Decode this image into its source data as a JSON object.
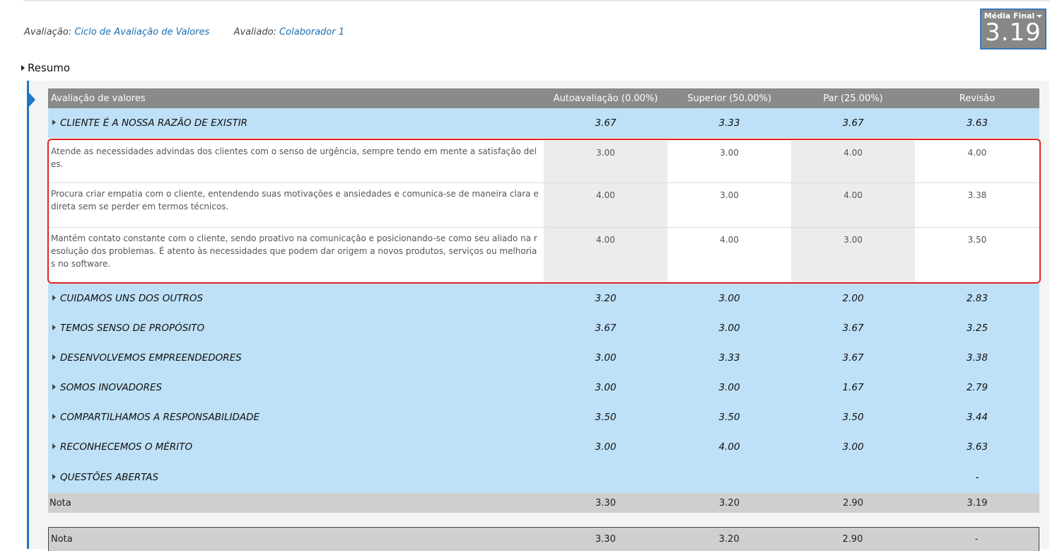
{
  "meta": {
    "evaluation_label": "Avaliação:",
    "evaluation_value": "Ciclo de Avaliação de Valores",
    "evaluated_label": "Avaliado:",
    "evaluated_value": "Colaborador 1"
  },
  "score": {
    "label": "Média Final",
    "value": "3.19"
  },
  "summary": {
    "label": "Resumo"
  },
  "table": {
    "headers": [
      "Avaliação de valores",
      "Autoavaliação (0.00%)",
      "Superior (50.00%)",
      "Par (25.00%)",
      "Revisão"
    ],
    "groups": [
      {
        "name": "CLIENTE É A NOSSA RAZÃO DE EXISTIR",
        "values": [
          "3.67",
          "3.33",
          "3.67",
          "3.63"
        ]
      },
      {
        "name": "CUIDAMOS UNS DOS OUTROS",
        "values": [
          "3.20",
          "3.00",
          "2.00",
          "2.83"
        ]
      },
      {
        "name": "TEMOS SENSO DE PROPÓSITO",
        "values": [
          "3.67",
          "3.00",
          "3.67",
          "3.25"
        ]
      },
      {
        "name": "DESENVOLVEMOS EMPREENDEDORES",
        "values": [
          "3.00",
          "3.33",
          "3.67",
          "3.38"
        ]
      },
      {
        "name": "SOMOS INOVADORES",
        "values": [
          "3.00",
          "3.00",
          "1.67",
          "2.79"
        ]
      },
      {
        "name": "COMPARTILHAMOS A RESPONSABILIDADE",
        "values": [
          "3.50",
          "3.50",
          "3.50",
          "3.44"
        ]
      },
      {
        "name": "RECONHECEMOS O MÉRITO",
        "values": [
          "3.00",
          "4.00",
          "3.00",
          "3.63"
        ]
      },
      {
        "name": "QUESTÕES ABERTAS",
        "values": [
          "",
          "",
          "",
          "-"
        ]
      }
    ],
    "details": [
      {
        "text": "Atende as necessidades advindas dos clientes com o senso de urgência, sempre tendo em mente a satisfação deles.",
        "values": [
          "3.00",
          "3.00",
          "4.00",
          "4.00"
        ]
      },
      {
        "text": "Procura criar empatia com o cliente, entendendo suas motivações e ansiedades e comunica-se de maneira clara e direta sem se perder em termos técnicos.",
        "values": [
          "4.00",
          "3.00",
          "4.00",
          "3.38"
        ]
      },
      {
        "text": "Mantém contato constante com o cliente, sendo proativo na comunicação e posicionando-se como seu aliado na resolução dos problemas. É atento às necessidades que podem dar origem a novos produtos, serviços ou melhorias no software.",
        "values": [
          "4.00",
          "4.00",
          "3.00",
          "3.50"
        ]
      }
    ],
    "total": {
      "label": "Nota",
      "values": [
        "3.30",
        "3.20",
        "2.90",
        "3.19"
      ]
    },
    "total2": {
      "label": "Nota",
      "values": [
        "3.30",
        "3.20",
        "2.90",
        "-"
      ]
    }
  },
  "colors": {
    "accent": "#1f77c4",
    "group_bg": "#bfe1f7",
    "header_bg": "#8a8a8a",
    "highlight": "#e02424"
  }
}
